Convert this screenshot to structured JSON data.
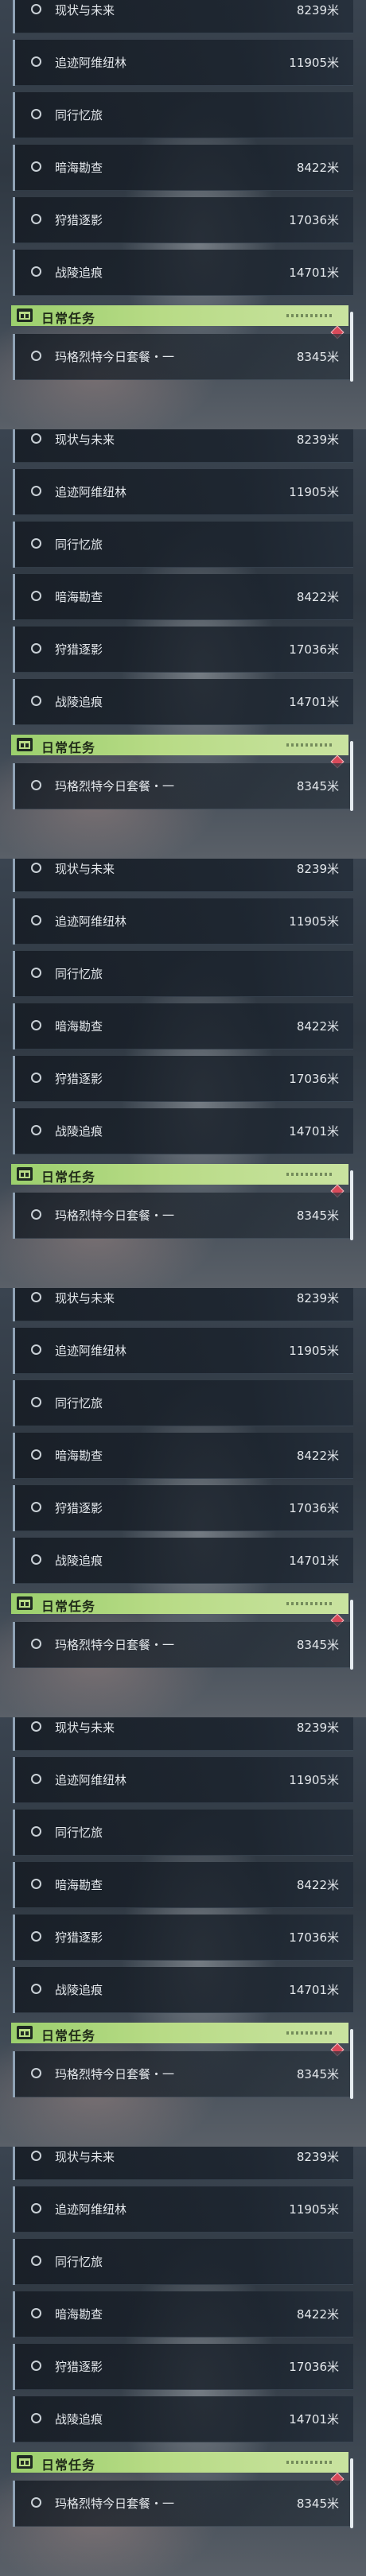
{
  "quests": [
    {
      "name": "现状与未来",
      "distance": "8239米"
    },
    {
      "name": "追迹阿维纽林",
      "distance": "11905米"
    },
    {
      "name": "同行忆旅",
      "distance": ""
    },
    {
      "name": "暗海勘查",
      "distance": "8422米"
    },
    {
      "name": "狩猎逐影",
      "distance": "17036米"
    },
    {
      "name": "战陵追痕",
      "distance": "14701米"
    }
  ],
  "daily_section": {
    "title": "日常任务",
    "quest": {
      "name": "玛格烈特今日套餐・一",
      "distance": "8345米"
    }
  },
  "icons": {
    "quest_marker": "radio-circle-icon",
    "daily_header": "task-board-icon",
    "alert": "red-diamond-icon"
  },
  "colors": {
    "daily_header_green": "#b8db86",
    "alert_red": "#d94a5a",
    "row_accent": "#8fa2b5"
  }
}
